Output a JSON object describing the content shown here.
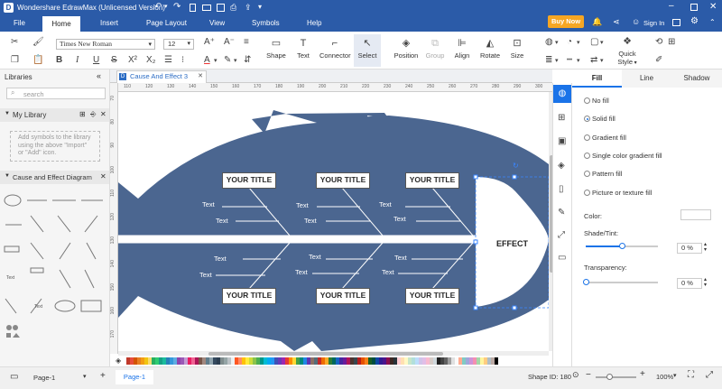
{
  "app": {
    "title": "Wondershare EdrawMax (Unlicensed Version)",
    "buy_label": "Buy Now",
    "signin_label": "Sign In"
  },
  "menu": {
    "items": [
      "File",
      "Home",
      "Insert",
      "Page Layout",
      "View",
      "Symbols",
      "Help"
    ]
  },
  "ribbon": {
    "font_name": "Times New Roman",
    "font_size": "12",
    "shape_label": "Shape",
    "text_label": "Text",
    "connector_label": "Connector",
    "select_label": "Select",
    "position_label": "Position",
    "group_label": "Group",
    "align_label": "Align",
    "rotate_label": "Rotate",
    "size_label": "Size",
    "quickstyle_line1": "Quick",
    "quickstyle_line2": "Style"
  },
  "libraries": {
    "header": "Libraries",
    "search_placeholder": "search",
    "my_library": "My Library",
    "my_library_hint": "Add symbols to the library using the above \"Import\" or \"Add\" icon.",
    "cause_effect": "Cause and Effect Diagram",
    "thumb_text": "Text"
  },
  "document": {
    "tab_name": "Cause And Effect 3",
    "ruler_top": [
      "110",
      "120",
      "130",
      "140",
      "150",
      "160",
      "170",
      "180",
      "190",
      "200",
      "210",
      "220",
      "230",
      "240",
      "250",
      "260",
      "270",
      "280",
      "290",
      "300"
    ],
    "ruler_left": [
      "70",
      "80",
      "90",
      "100",
      "110",
      "120",
      "130",
      "140",
      "150",
      "160",
      "170"
    ]
  },
  "diagram": {
    "effect": "EFFECT",
    "titles": [
      "YOUR TITLE",
      "YOUR TITLE",
      "YOUR TITLE",
      "YOUR TITLE",
      "YOUR TITLE",
      "YOUR TITLE"
    ],
    "texts": [
      "Text",
      "Text",
      "Text",
      "Text",
      "Text",
      "Text",
      "Text",
      "Text",
      "Text",
      "Text",
      "Text",
      "Text"
    ],
    "fish_color": "#4b6690"
  },
  "panel": {
    "tabs": [
      "Fill",
      "Line",
      "Shadow"
    ],
    "options": [
      "No fill",
      "Solid fill",
      "Gradient fill",
      "Single color gradient fill",
      "Pattern fill",
      "Picture or texture fill"
    ],
    "selected_option": "Solid fill",
    "color_label": "Color:",
    "shade_label": "Shade/Tint:",
    "shade_value": "0 %",
    "shade_level": 0.5,
    "transparency_label": "Transparency:",
    "transparency_value": "0 %",
    "transparency_level": 0
  },
  "status": {
    "page_selector": "Page-1",
    "page_tab": "Page-1",
    "shape_id": "Shape ID: 180",
    "zoom": "100%"
  },
  "palette_colors": [
    "#c0392b",
    "#e74c3c",
    "#d35400",
    "#e67e22",
    "#f39c12",
    "#f1c40f",
    "#f7dc6f",
    "#27ae60",
    "#2ecc71",
    "#16a085",
    "#1abc9c",
    "#2980b9",
    "#3498db",
    "#5dade2",
    "#8e44ad",
    "#9b59b6",
    "#c39bd3",
    "#e91e63",
    "#f06292",
    "#ad1457",
    "#795548",
    "#a1887f",
    "#607d8b",
    "#90a4ae",
    "#34495e",
    "#2c3e50",
    "#7f8c8d",
    "#95a5a6",
    "#bdc3c7",
    "#ecf0f1",
    "#ff5722",
    "#ff8a65",
    "#ffc107",
    "#ffeb3b",
    "#cddc39",
    "#8bc34a",
    "#4caf50",
    "#009688",
    "#00bcd4",
    "#03a9f4",
    "#2196f3",
    "#3f51b5",
    "#673ab7",
    "#9c27b0",
    "#e53935",
    "#fb8c00",
    "#fdd835",
    "#43a047",
    "#00897b",
    "#1e88e5",
    "#5e35b1",
    "#8d6e63",
    "#546e7a",
    "#c62828",
    "#ef6c00",
    "#f9a825",
    "#2e7d32",
    "#00695c",
    "#1565c0",
    "#4527a0",
    "#6a1b9a",
    "#ad1457",
    "#4e342e",
    "#37474f",
    "#b71c1c",
    "#e65100",
    "#f57f17",
    "#1b5e20",
    "#004d40",
    "#0d47a1",
    "#311b92",
    "#4a148c",
    "#880e4f",
    "#3e2723",
    "#263238",
    "#ffcdd2",
    "#ffe0b2",
    "#fff9c4",
    "#c8e6c9",
    "#b2dfdb",
    "#bbdefb",
    "#d1c4e9",
    "#e1bee7",
    "#f8bbd0",
    "#d7ccc8",
    "#cfd8dc",
    "#212121",
    "#424242",
    "#616161",
    "#9e9e9e",
    "#e0e0e0",
    "#fafafa",
    "#ffab91",
    "#80cbc4",
    "#9fa8da",
    "#ce93d8",
    "#f48fb1",
    "#a5d6a7",
    "#fff59d",
    "#ffcc80",
    "#b0bec5",
    "#bcaaa4",
    "#000000"
  ]
}
